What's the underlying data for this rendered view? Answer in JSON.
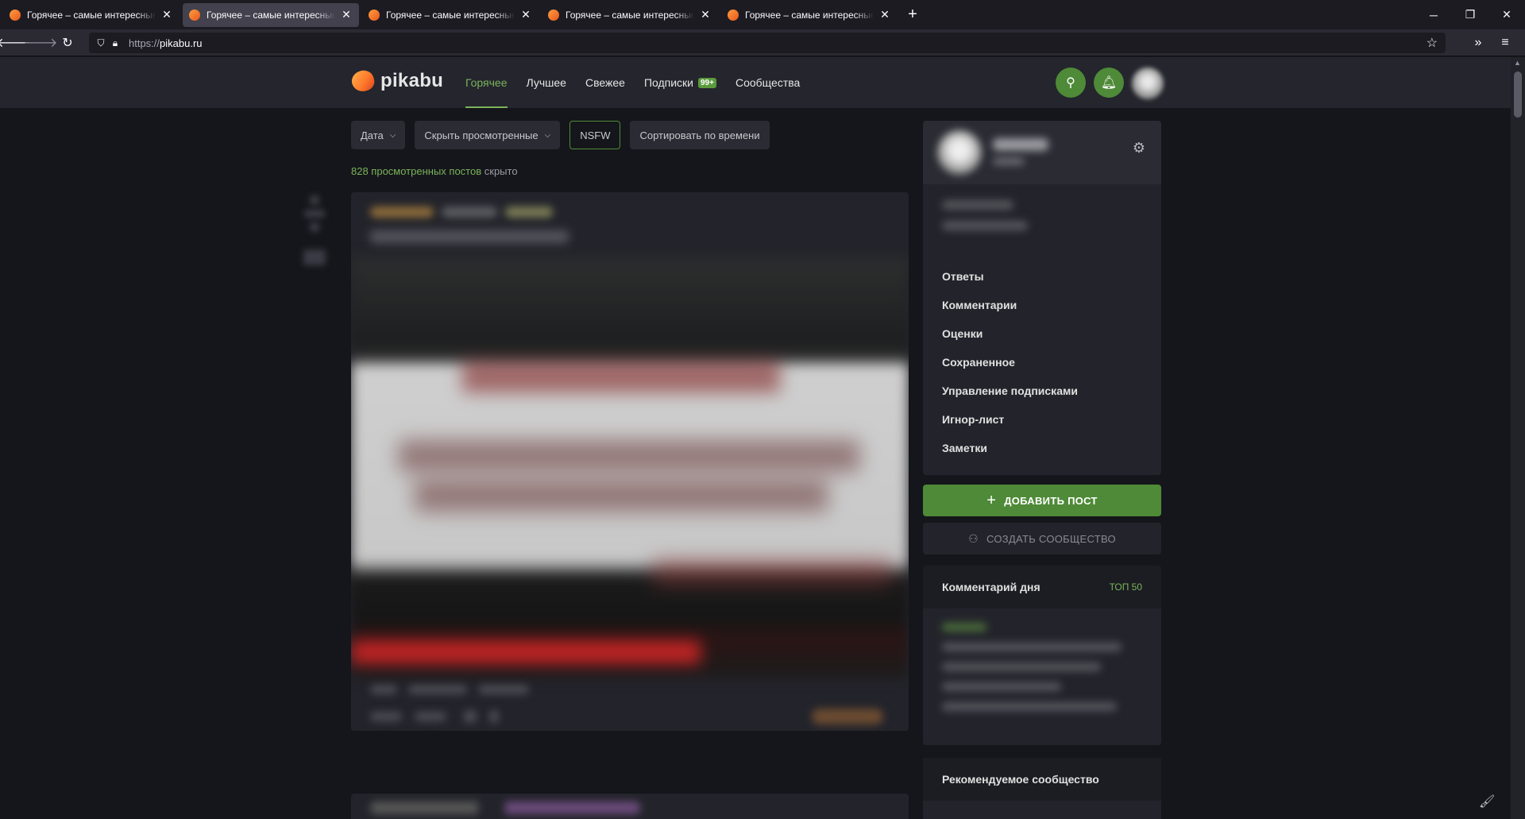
{
  "browser": {
    "tabs": [
      {
        "title": "Горячее – самые интересные и обсуждаемые посты | Пикабу",
        "active": false
      },
      {
        "title": "Горячее – самые интересные и обсуждаемые посты | Пикабу",
        "active": true
      },
      {
        "title": "Горячее – самые интересные и обсуждаемые посты | Пикабу",
        "active": false
      },
      {
        "title": "Горячее – самые интересные и обсуждаемые посты | Пикабу",
        "active": false
      },
      {
        "title": "Горячее – самые интересные и обсуждаемые посты | Пикабу",
        "active": false
      }
    ],
    "url_proto": "https://",
    "url_host": "pikabu.ru"
  },
  "site": {
    "logo_text": "pikabu",
    "nav": [
      {
        "label": "Горячее",
        "active": true
      },
      {
        "label": "Лучшее"
      },
      {
        "label": "Свежее"
      },
      {
        "label": "Подписки",
        "badge": "99+"
      },
      {
        "label": "Сообщества"
      }
    ],
    "accent_color": "#4e8a37"
  },
  "filters": {
    "date": "Дата",
    "hide_viewed": "Скрыть просмотренные",
    "nsfw": "NSFW",
    "sort": "Сортировать по времени"
  },
  "hidden_info": {
    "count_text": "828 просмотренных постов",
    "suffix": "скрыто"
  },
  "sidebar": {
    "menu": [
      "Ответы",
      "Комментарии",
      "Оценки",
      "Сохраненное",
      "Управление подписками",
      "Игнор-лист",
      "Заметки"
    ],
    "add_post": "ДОБАВИТЬ ПОСТ",
    "create_community": "СОЗДАТЬ СООБЩЕСТВО",
    "comment_of_day": "Комментарий дня",
    "top50": "ТОП 50",
    "recommended": "Рекомендуемое сообщество"
  }
}
